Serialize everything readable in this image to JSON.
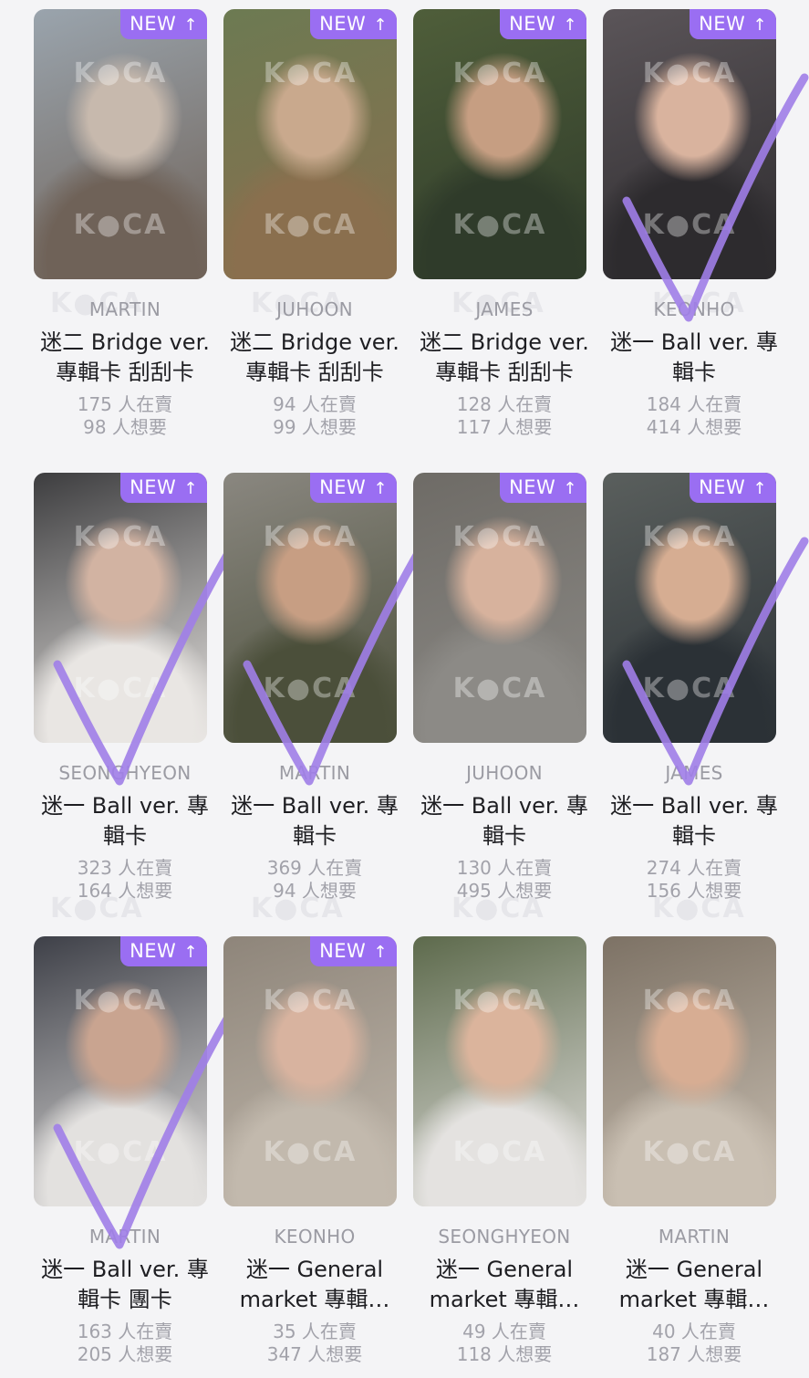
{
  "badge_label": "NEW",
  "stats_sell_suffix": "人在賣",
  "stats_want_suffix": "人想要",
  "accent_color": "#9a6ef2",
  "check_color": "#a07ee8",
  "watermark": "K●CA",
  "cards": [
    {
      "member": "MARTIN",
      "title1": "迷二 Bridge ver.",
      "title2": "專輯卡 刮刮卡",
      "sell": "175",
      "want": "98",
      "is_new": true,
      "checked": false,
      "photo": [
        "#9aa4ad",
        "#c7b9ad",
        "#6f6258"
      ]
    },
    {
      "member": "JUHOON",
      "title1": "迷二 Bridge ver.",
      "title2": "專輯卡 刮刮卡",
      "sell": "94",
      "want": "99",
      "is_new": true,
      "checked": false,
      "photo": [
        "#6c7a52",
        "#c9a98d",
        "#8a6f4e"
      ]
    },
    {
      "member": "JAMES",
      "title1": "迷二 Bridge ver.",
      "title2": "專輯卡 刮刮卡",
      "sell": "128",
      "want": "117",
      "is_new": true,
      "checked": false,
      "photo": [
        "#4f5e3a",
        "#c69e82",
        "#2f3b2a"
      ]
    },
    {
      "member": "KEONHO",
      "title1": "迷一 Ball ver. 專",
      "title2": "輯卡",
      "sell": "184",
      "want": "414",
      "is_new": true,
      "checked": true,
      "photo": [
        "#5b5559",
        "#d9b39e",
        "#2d2b2e"
      ]
    },
    {
      "member": "SEONGHYEON",
      "title1": "迷一 Ball ver. 專",
      "title2": "輯卡",
      "sell": "323",
      "want": "164",
      "is_new": true,
      "checked": true,
      "photo": [
        "#3d3d3f",
        "#d2b3a2",
        "#e9e6e3"
      ]
    },
    {
      "member": "MARTIN",
      "title1": "迷一 Ball ver. 專",
      "title2": "輯卡",
      "sell": "369",
      "want": "94",
      "is_new": true,
      "checked": true,
      "photo": [
        "#8a8780",
        "#c79e83",
        "#4b4f3a"
      ]
    },
    {
      "member": "JUHOON",
      "title1": "迷一 Ball ver. 專",
      "title2": "輯卡",
      "sell": "130",
      "want": "495",
      "is_new": true,
      "checked": false,
      "photo": [
        "#6e6b66",
        "#d7b29d",
        "#8c8a86"
      ]
    },
    {
      "member": "JAMES",
      "title1": "迷一 Ball ver. 專",
      "title2": "輯卡",
      "sell": "274",
      "want": "156",
      "is_new": true,
      "checked": true,
      "photo": [
        "#5a5f5d",
        "#d6ad92",
        "#2b3136"
      ]
    },
    {
      "member": "MARTIN",
      "title1": "迷一 Ball ver. 專",
      "title2": "輯卡 團卡",
      "sell": "163",
      "want": "205",
      "is_new": true,
      "checked": true,
      "photo": [
        "#3e4048",
        "#c9a490",
        "#e3e1df"
      ]
    },
    {
      "member": "KEONHO",
      "title1": "迷一 General",
      "title2": "market 專輯…",
      "sell": "35",
      "want": "347",
      "is_new": true,
      "checked": false,
      "photo": [
        "#8e857a",
        "#d8b39f",
        "#c2b9ad"
      ]
    },
    {
      "member": "SEONGHYEON",
      "title1": "迷一 General",
      "title2": "market 專輯…",
      "sell": "49",
      "want": "118",
      "is_new": false,
      "checked": false,
      "photo": [
        "#5d6a4c",
        "#dbb49c",
        "#e4e2e0"
      ]
    },
    {
      "member": "MARTIN",
      "title1": "迷一 General",
      "title2": "market 專輯…",
      "sell": "40",
      "want": "187",
      "is_new": false,
      "checked": false,
      "photo": [
        "#7d7265",
        "#d7ad93",
        "#c9bfb2"
      ]
    }
  ]
}
